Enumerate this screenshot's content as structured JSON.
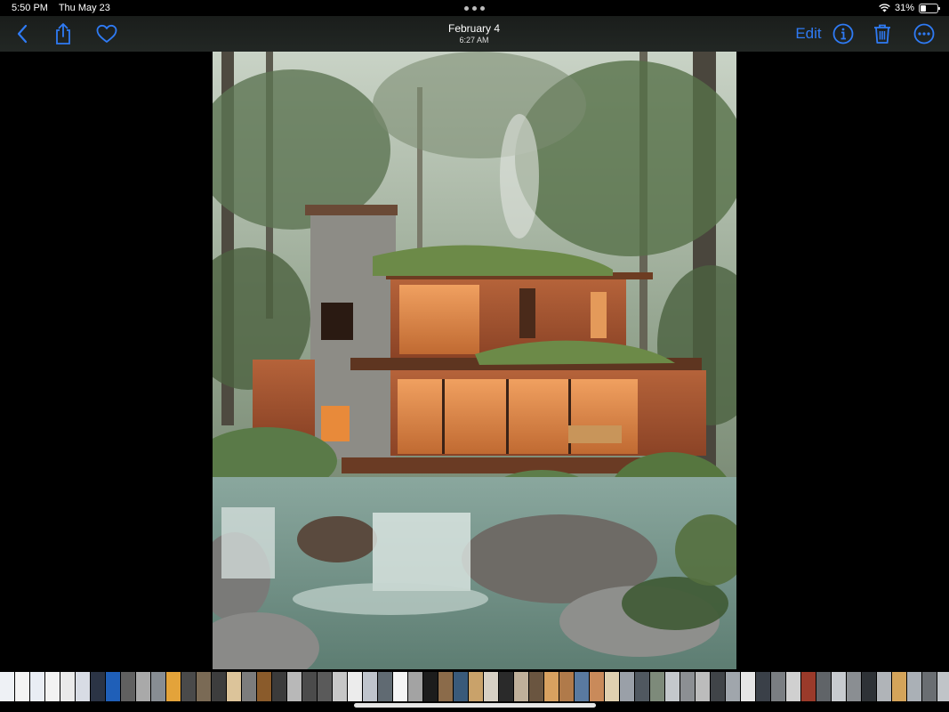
{
  "status_bar": {
    "time": "5:50 PM",
    "date": "Thu May 23",
    "battery_text": "31%",
    "battery_level": 0.31,
    "wifi_icon": "wifi-icon"
  },
  "toolbar": {
    "back_icon": "chevron-left-icon",
    "share_icon": "share-icon",
    "favorite_icon": "heart-icon",
    "title_date": "February 4",
    "title_time": "6:27 AM",
    "edit_label": "Edit",
    "info_icon": "info-icon",
    "delete_icon": "trash-icon",
    "more_icon": "ellipsis-circle-icon",
    "accent_color": "#2f7bf5"
  },
  "photo": {
    "description_icon": "photo-image"
  },
  "thumbnail_strip": {
    "colors": [
      "#eef1f5",
      "#f4f4f4",
      "#e9edf4",
      "#f2f2f2",
      "#eaeaea",
      "#d8dce4",
      "#2b3445",
      "#1f5fb8",
      "#606060",
      "#a9a9a9",
      "#878d93",
      "#e3a33a",
      "#4a4a4a",
      "#7a6a55",
      "#3d3d3d",
      "#dcc49a",
      "#7c7c7c",
      "#8a5b2b",
      "#3b3b3b",
      "#b8b8b8",
      "#4b4b4b",
      "#5a5a5a",
      "#c7c7c7",
      "#ececec",
      "#bfc4cc",
      "#606a72",
      "#f5f5f5",
      "#a3a3a3",
      "#1c1c1c",
      "#8b6b4a",
      "#3a5a7a",
      "#c9a26a",
      "#d7d0c4",
      "#2a2a2a",
      "#c0b09a",
      "#6a5540",
      "#d8a160",
      "#b07a4a",
      "#5a7aa0",
      "#c98a5a",
      "#e0d0b0",
      "#9aa0a8",
      "#505860",
      "#7d8a7a",
      "#c4c8cc",
      "#8c8f93",
      "#bcbcbc",
      "#404448",
      "#a0a6ac",
      "#e5e5e5",
      "#3a4048",
      "#7a7e82",
      "#d0d0d0",
      "#9a3a2a",
      "#606468",
      "#c7cbcf",
      "#8a8e92",
      "#2e3236",
      "#b0b4b8",
      "#d4a45a",
      "#aab0b6",
      "#6a6e72",
      "#c0c4c8",
      "#e8e8e8",
      "#5a5e62"
    ]
  }
}
